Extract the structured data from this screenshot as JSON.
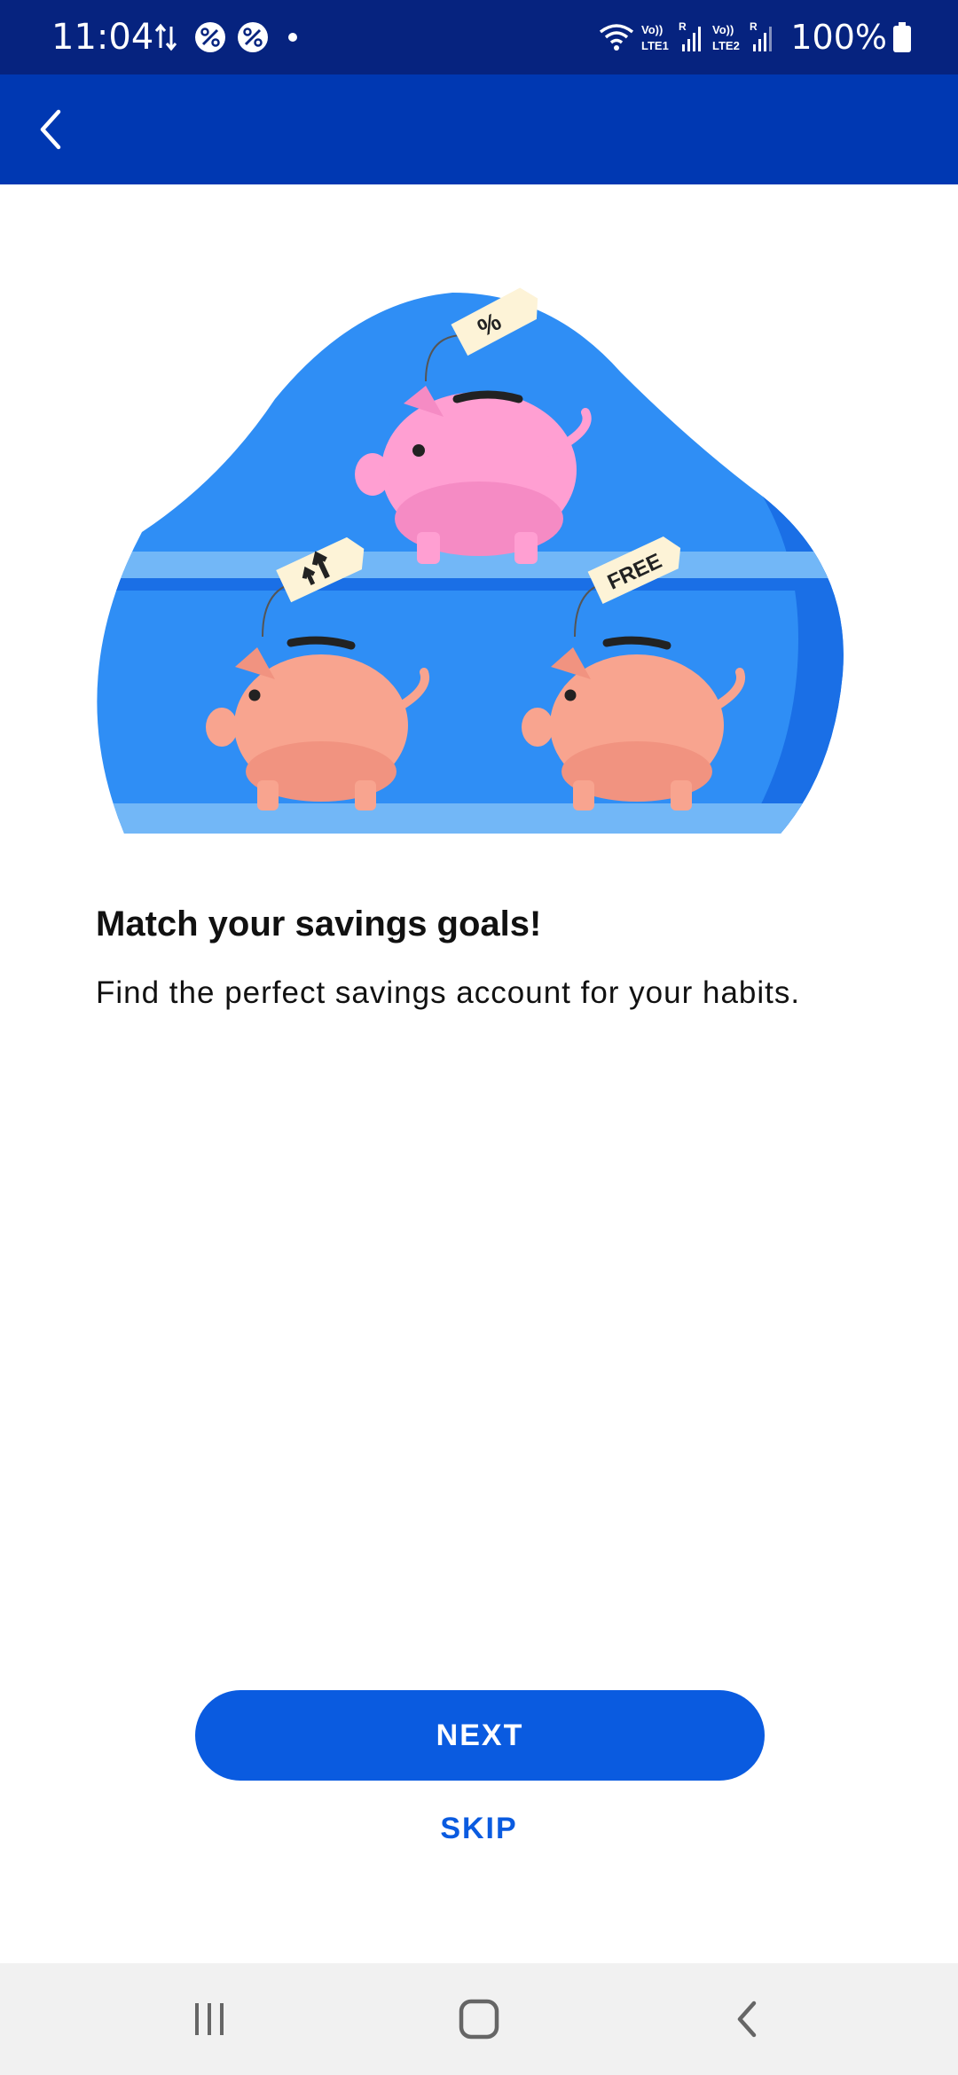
{
  "status_bar": {
    "time": "11:04",
    "battery": "100%",
    "icons": [
      "data-transfer-icon",
      "app-notification-icon",
      "app-notification-icon",
      "dot-icon",
      "wifi-icon",
      "lte1-signal-icon",
      "lte2-signal-icon",
      "battery-icon"
    ]
  },
  "app_bar": {
    "back_icon": "chevron-left-icon",
    "background": "#0038b2"
  },
  "hero": {
    "tags": [
      "%",
      "FREE"
    ],
    "colors": {
      "blob": "#2f8ef5",
      "pig_top": "#ff9fd2",
      "pig_bottom": "#f8a48f"
    }
  },
  "content": {
    "headline": "Match your savings goals!",
    "subtitle": "Find the perfect savings account for your habits."
  },
  "actions": {
    "next_label": "NEXT",
    "skip_label": "SKIP",
    "accent": "#0a5be0"
  },
  "nav_bar": {
    "icons": [
      "recent-apps-icon",
      "home-icon",
      "back-icon"
    ]
  }
}
